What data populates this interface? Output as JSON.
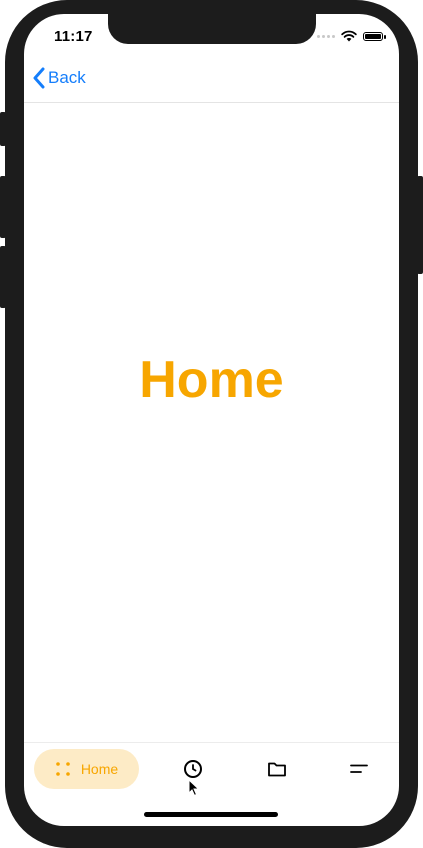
{
  "status_bar": {
    "time": "11:17"
  },
  "navbar": {
    "back_label": "Back"
  },
  "main": {
    "title": "Home"
  },
  "tab_bar": {
    "tabs": [
      {
        "label": "Home",
        "icon": "grid-dots-icon",
        "active": true
      },
      {
        "label": "",
        "icon": "clock-icon",
        "active": false
      },
      {
        "label": "",
        "icon": "folder-icon",
        "active": false
      },
      {
        "label": "",
        "icon": "menu-icon",
        "active": false
      }
    ]
  },
  "colors": {
    "accent": "#f7a600",
    "accent_bg": "#fdebc6",
    "link": "#157efb"
  }
}
